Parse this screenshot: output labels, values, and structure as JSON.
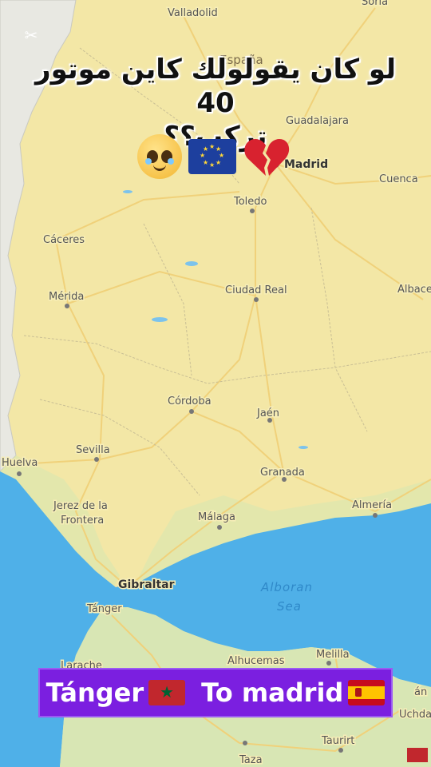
{
  "overlay": {
    "title_line1": "لو كان يقولولك كاين موتور 40",
    "title_line2": "تركب؟؟",
    "emojis": [
      "pleading-face",
      "eu-flag",
      "broken-heart"
    ]
  },
  "banner": {
    "from": "Tánger",
    "to_text": "To madrid",
    "from_flag": "morocco-flag",
    "to_flag": "spain-flag"
  },
  "map": {
    "country": "España",
    "sea": [
      "Alboran",
      "Sea"
    ],
    "cities": {
      "soria": "Soria",
      "valladolid": "Valladolid",
      "guadalajara": "Guadalajara",
      "madrid": "Madrid",
      "cuenca": "Cuenca",
      "toledo": "Toledo",
      "caceres": "Cáceres",
      "merida": "Mérida",
      "ciudad_real": "Ciudad Real",
      "albacete": "Albace",
      "cordoba": "Córdoba",
      "jaen": "Jaén",
      "sevilla": "Sevilla",
      "huelva": "Huelva",
      "granada": "Granada",
      "jerez1": "Jerez de la",
      "jerez2": "Frontera",
      "malaga": "Málaga",
      "almeria": "Almería",
      "gibraltar": "Gibraltar",
      "tanger": "Tánger",
      "larache": "Larache",
      "alhucemas": "Alhucemas",
      "melilla": "Melilla",
      "taourirt": "Taurirt",
      "uchda": "Uchda",
      "taza": "Taza",
      "nador": "án"
    },
    "colors": {
      "land": "#f3e7a6",
      "sea": "#4fb0e8",
      "portugal": "#e9e9e4",
      "roads": "#f0d98a"
    }
  }
}
